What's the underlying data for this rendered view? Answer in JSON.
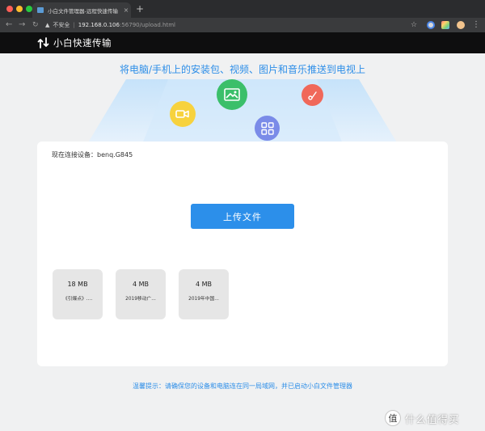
{
  "browser": {
    "tab_title": "小白文件管理器-远程快速传输",
    "tab_close": "×",
    "new_tab": "+",
    "nav_back": "←",
    "nav_forward": "→",
    "nav_reload": "↻",
    "security_label": "不安全",
    "security_sep": "|",
    "url_host": "192.168.0.106",
    "url_path": ":56790/upload.html",
    "bookmark_star": "☆",
    "menu": "⋮"
  },
  "app": {
    "title": "小白快速传输",
    "hero_text": "将电脑/手机上的安装包、视频、图片和音乐推送到电视上",
    "device_label": "现在连接设备：",
    "device_name": "benq.G845",
    "upload_button": "上传文件",
    "files": [
      {
        "size": "18 MB",
        "name": "《引爆点》...."
      },
      {
        "size": "4 MB",
        "name": "2019移动广..."
      },
      {
        "size": "4 MB",
        "name": "2019年中国..."
      }
    ],
    "tip": "温馨提示：请确保您的设备和电脑连在同一局域网，并已启动小白文件管理器"
  },
  "watermark": {
    "badge": "值",
    "text": "什么值得买"
  },
  "colors": {
    "accent": "#2c8fea",
    "header_bg": "#0e0e0f",
    "page_bg": "#f0f1f2",
    "bubble_camera": "#f7d23e",
    "bubble_image": "#3bbf6a",
    "bubble_apps": "#7a8be8",
    "bubble_music": "#f0685a"
  },
  "icons": [
    "tab-favicon",
    "warning-icon",
    "star-icon",
    "menu-icon",
    "transfer-logo-icon",
    "video-camera-icon",
    "image-icon",
    "apps-grid-icon",
    "music-note-icon"
  ]
}
